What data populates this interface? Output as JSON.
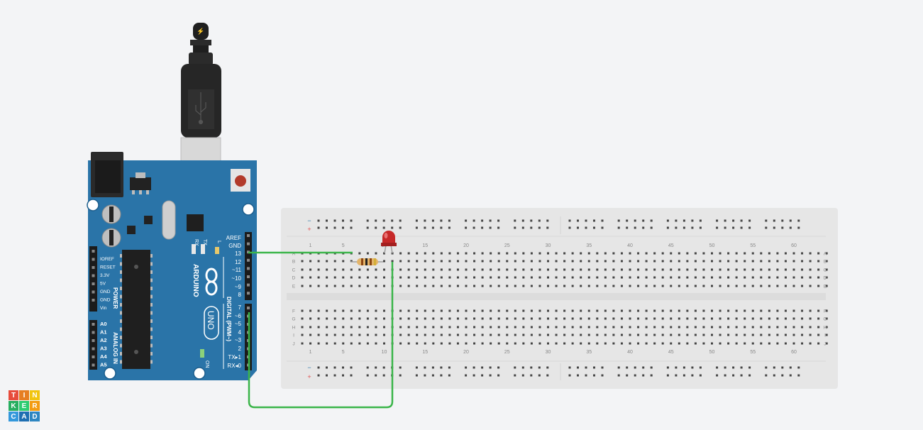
{
  "colors": {
    "background": "#f3f4f6",
    "arduino_board": "#2a74a8",
    "breadboard": "#e6e6e6",
    "wire": "#3bb54a",
    "led": "#c62828",
    "logo_cells": [
      "#e74c3c",
      "#e67e22",
      "#f1c40f",
      "#27ae60",
      "#2ecc71",
      "#f39c12",
      "#3498db",
      "#1f6fb2",
      "#2e86c1"
    ]
  },
  "usb": {
    "plug_icon": "lightning-icon",
    "connector_icon": "usb-icon"
  },
  "arduino": {
    "brand": "ARDUINO",
    "model": "UNO",
    "led_labels": {
      "tx": "TX",
      "rx": "RX",
      "l": "L",
      "on": "ON"
    },
    "digital_title": "DIGITAL (PWM~)",
    "digital_pins": [
      "AREF",
      "GND",
      "13",
      "12",
      "~11",
      "~10",
      "~9",
      "8",
      "7",
      "~6",
      "~5",
      "4",
      "~3",
      "2",
      "TX▸1",
      "RX◂0"
    ],
    "power_title": "POWER",
    "power_pins": [
      "IOREF",
      "RESET",
      "3.3V",
      "5V",
      "GND",
      "GND",
      "Vin"
    ],
    "analog_title": "ANALOG IN",
    "analog_pins": [
      "A0",
      "A1",
      "A2",
      "A3",
      "A4",
      "A5"
    ]
  },
  "breadboard": {
    "rail_minus": "−",
    "rail_plus": "+",
    "col_numbers": [
      "1",
      "5",
      "10",
      "15",
      "20",
      "25",
      "30",
      "35",
      "40",
      "45",
      "50",
      "55",
      "60"
    ],
    "rows_top": [
      "A",
      "B",
      "C",
      "D",
      "E"
    ],
    "rows_bottom": [
      "F",
      "G",
      "H",
      "I",
      "J"
    ]
  },
  "logo": {
    "letters": [
      "T",
      "I",
      "N",
      "K",
      "E",
      "R",
      "C",
      "A",
      "D"
    ]
  }
}
